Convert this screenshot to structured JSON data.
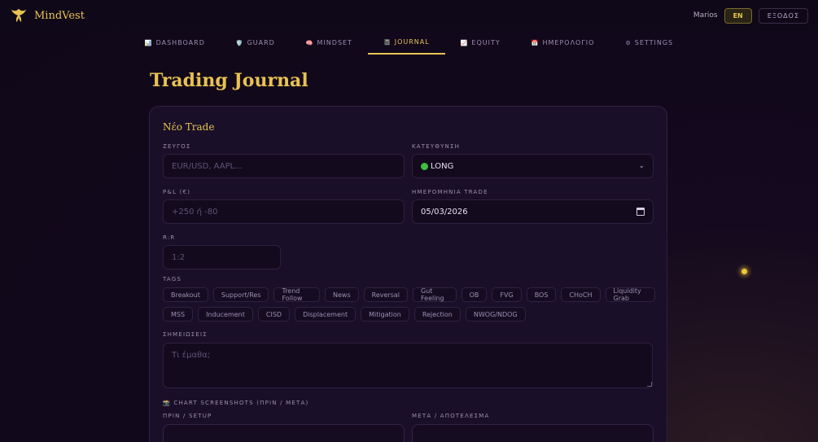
{
  "app": {
    "name": "MindVest"
  },
  "header": {
    "user": "Marios",
    "lang": "EN",
    "logout": "ΕΞΟΔΟΣ"
  },
  "nav": {
    "tabs": [
      {
        "icon": "📊",
        "label": "DASHBOARD"
      },
      {
        "icon": "🛡️",
        "label": "GUARD"
      },
      {
        "icon": "🧠",
        "label": "MINDSET"
      },
      {
        "icon": "📓",
        "label": "JOURNAL"
      },
      {
        "icon": "📈",
        "label": "EQUITY"
      },
      {
        "icon": "📅",
        "label": "ΗΜΕΡΟΛΟΓΙΟ"
      },
      {
        "icon": "⚙",
        "label": "SETTINGS"
      }
    ],
    "active": "JOURNAL"
  },
  "page": {
    "title": "Trading Journal"
  },
  "form": {
    "title": "Νέο Trade",
    "pair": {
      "label": "ΖΕΥΓΟΣ",
      "placeholder": "EUR/USD, AAPL..."
    },
    "direction": {
      "label": "ΚΑΤΕΥΘΥΝΣΗ",
      "value": "LONG"
    },
    "pnl": {
      "label": "P&L (€)",
      "placeholder": "+250 ή -80"
    },
    "date": {
      "label": "ΗΜΕΡΟΜΗΝΙΑ TRADE",
      "value": "05/03/2026"
    },
    "rr": {
      "label": "R:R",
      "placeholder": "1:2"
    },
    "tags": {
      "label": "TAGS",
      "row1": [
        "Breakout",
        "Support/Res",
        "Trend Follow",
        "News",
        "Reversal",
        "Gut Feeling",
        "OB",
        "FVG",
        "BOS",
        "CHoCH",
        "Liquidity Grab"
      ],
      "row2": [
        "MSS",
        "Inducement",
        "CISD",
        "Displacement",
        "Mitigation",
        "Rejection",
        "NWOG/NDOG"
      ]
    },
    "notes": {
      "label": "ΣΗΜΕΙΩΣΕΙΣ",
      "placeholder": "Τι έμαθα;"
    },
    "screenshots": {
      "icon": "📸",
      "label": "CHART SCREENSHOTS (ΠΡΙΝ / ΜΕΤΑ)",
      "before": "ΠΡΙΝ / SETUP",
      "after": "ΜΕΤΑ / ΑΠΟΤΕΛΕΣΜΑ"
    }
  },
  "colors": {
    "accent": "#e8c252",
    "background": "#12081c",
    "long": "#3fbf3f"
  }
}
